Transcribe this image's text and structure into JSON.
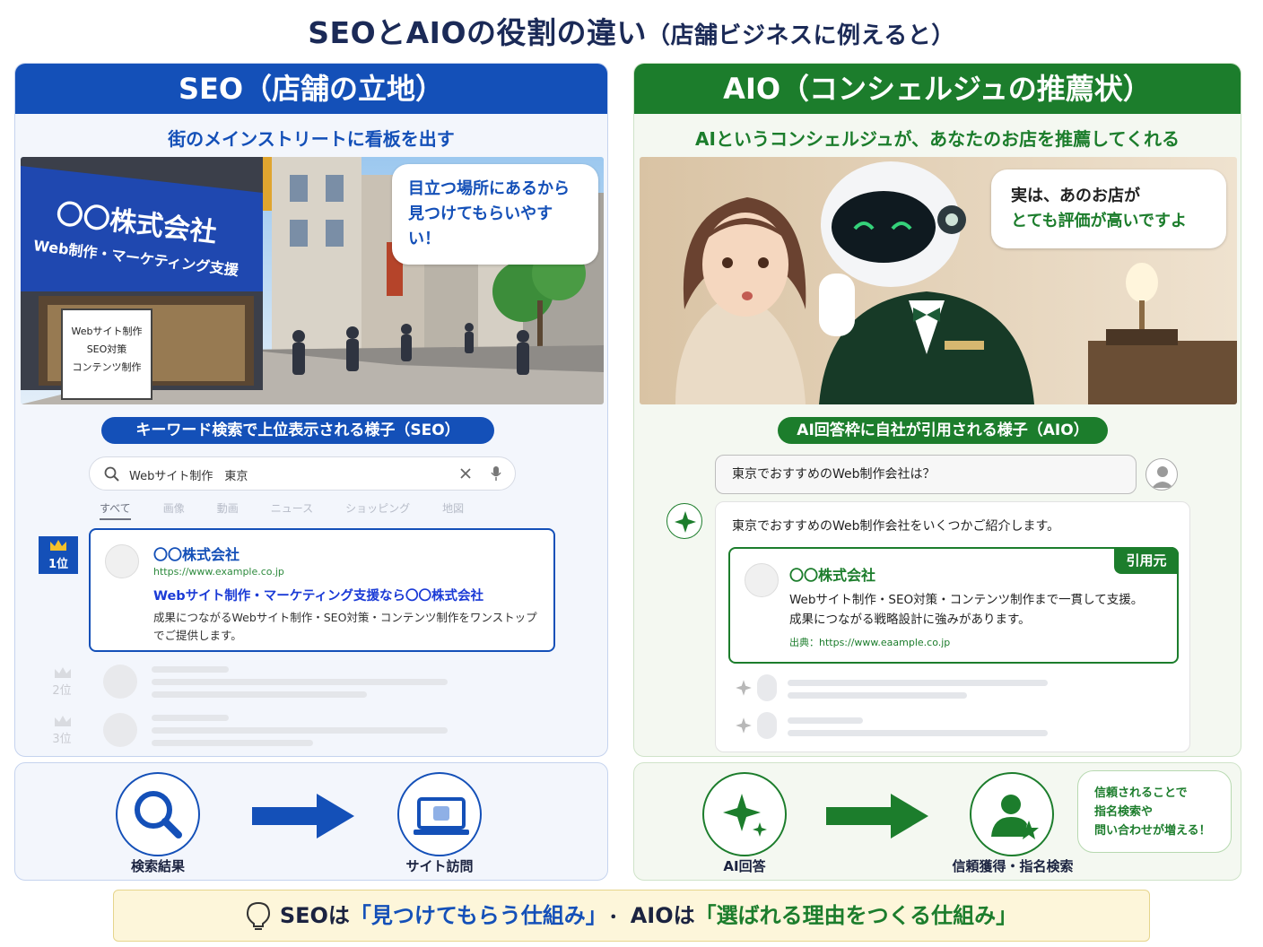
{
  "title": {
    "main": "SEOとAIOの役割の違い",
    "sub": "（店舗ビジネスに例えると）"
  },
  "colors": {
    "seo_blue": "#1450b8",
    "aio_green": "#1c7d2c",
    "summary_bg": "#fdf6da"
  },
  "seo": {
    "header": "SEO（店舗の立地）",
    "subtitle": "街のメインストリートに看板を出す",
    "scene_sign_name": "〇〇株式会社",
    "scene_sign_sub": "Web制作・マーケティング支援",
    "scene_board": [
      "Webサイト制作",
      "SEO対策",
      "コンテンツ制作"
    ],
    "bubble": [
      "目立つ場所にあるから",
      "見つけてもらいやすい！"
    ],
    "pill": "キーワード検索で上位表示される様子（SEO）",
    "search_query": "Webサイト制作　東京",
    "tabs": [
      "すべて",
      "画像",
      "動画",
      "ニュース",
      "ショッピング",
      "地図"
    ],
    "rank1": "1位",
    "rank2": "2位",
    "rank3": "3位",
    "result": {
      "name": "〇〇株式会社",
      "url": "https://www.example.co.jp",
      "title": "Webサイト制作・マーケティング支援なら〇〇株式会社",
      "desc": "成果につながるWebサイト制作・SEO対策・コンテンツ制作をワンストップでご提供します。"
    },
    "flow": {
      "left_icon": "search-icon",
      "left_label": "検索結果",
      "right_icon": "laptop-icon",
      "right_label": "サイト訪問"
    }
  },
  "aio": {
    "header": "AIO（コンシェルジュの推薦状）",
    "subtitle": "AIというコンシェルジュが、あなたのお店を推薦してくれる",
    "bubble": [
      "実は、あのお店が",
      "とても評価が高いですよ"
    ],
    "pill": "AI回答枠に自社が引用される様子（AIO）",
    "question": "東京でおすすめのWeb制作会社は？",
    "answer_intro": "東京でおすすめのWeb制作会社をいくつかご紹介します。",
    "citation": {
      "tag": "引用元",
      "name": "〇〇株式会社",
      "desc1": "Webサイト制作・SEO対策・コンテンツ制作まで一貫して支援。",
      "desc2": "成果につながる戦略設計に強みがあります。",
      "source": "出典：https://www.eaample.co.jp"
    },
    "flow": {
      "left_icon": "sparkle-icon",
      "left_label": "AI回答",
      "right_icon": "person-star-icon",
      "right_label": "信頼獲得・指名検索",
      "note": [
        "信頼されることで",
        "指名検索や",
        "問い合わせが増える！"
      ]
    }
  },
  "summary": {
    "p1": "SEOは",
    "q1": "「見つけてもらう仕組み」",
    "sep": "・",
    "p2": "AIOは",
    "q2": "「選ばれる理由をつくる仕組み」",
    "icon": "lightbulb-icon"
  }
}
